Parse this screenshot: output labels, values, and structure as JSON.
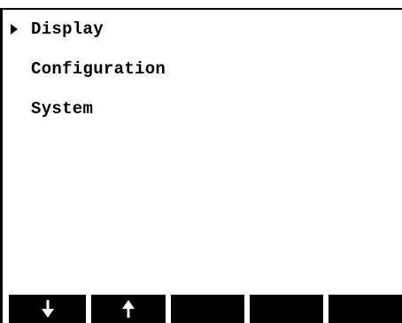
{
  "menu": {
    "items": [
      {
        "label": "Display",
        "selected": true
      },
      {
        "label": "Configuration",
        "selected": false
      },
      {
        "label": "System",
        "selected": false
      }
    ]
  },
  "softkeys": [
    {
      "icon": "down-arrow-icon"
    },
    {
      "icon": "up-arrow-icon"
    },
    {
      "icon": ""
    },
    {
      "icon": ""
    },
    {
      "icon": ""
    }
  ],
  "colors": {
    "background": "#ffffff",
    "foreground": "#000000",
    "softkey_background": "#000000",
    "softkey_icon": "#ffffff"
  }
}
